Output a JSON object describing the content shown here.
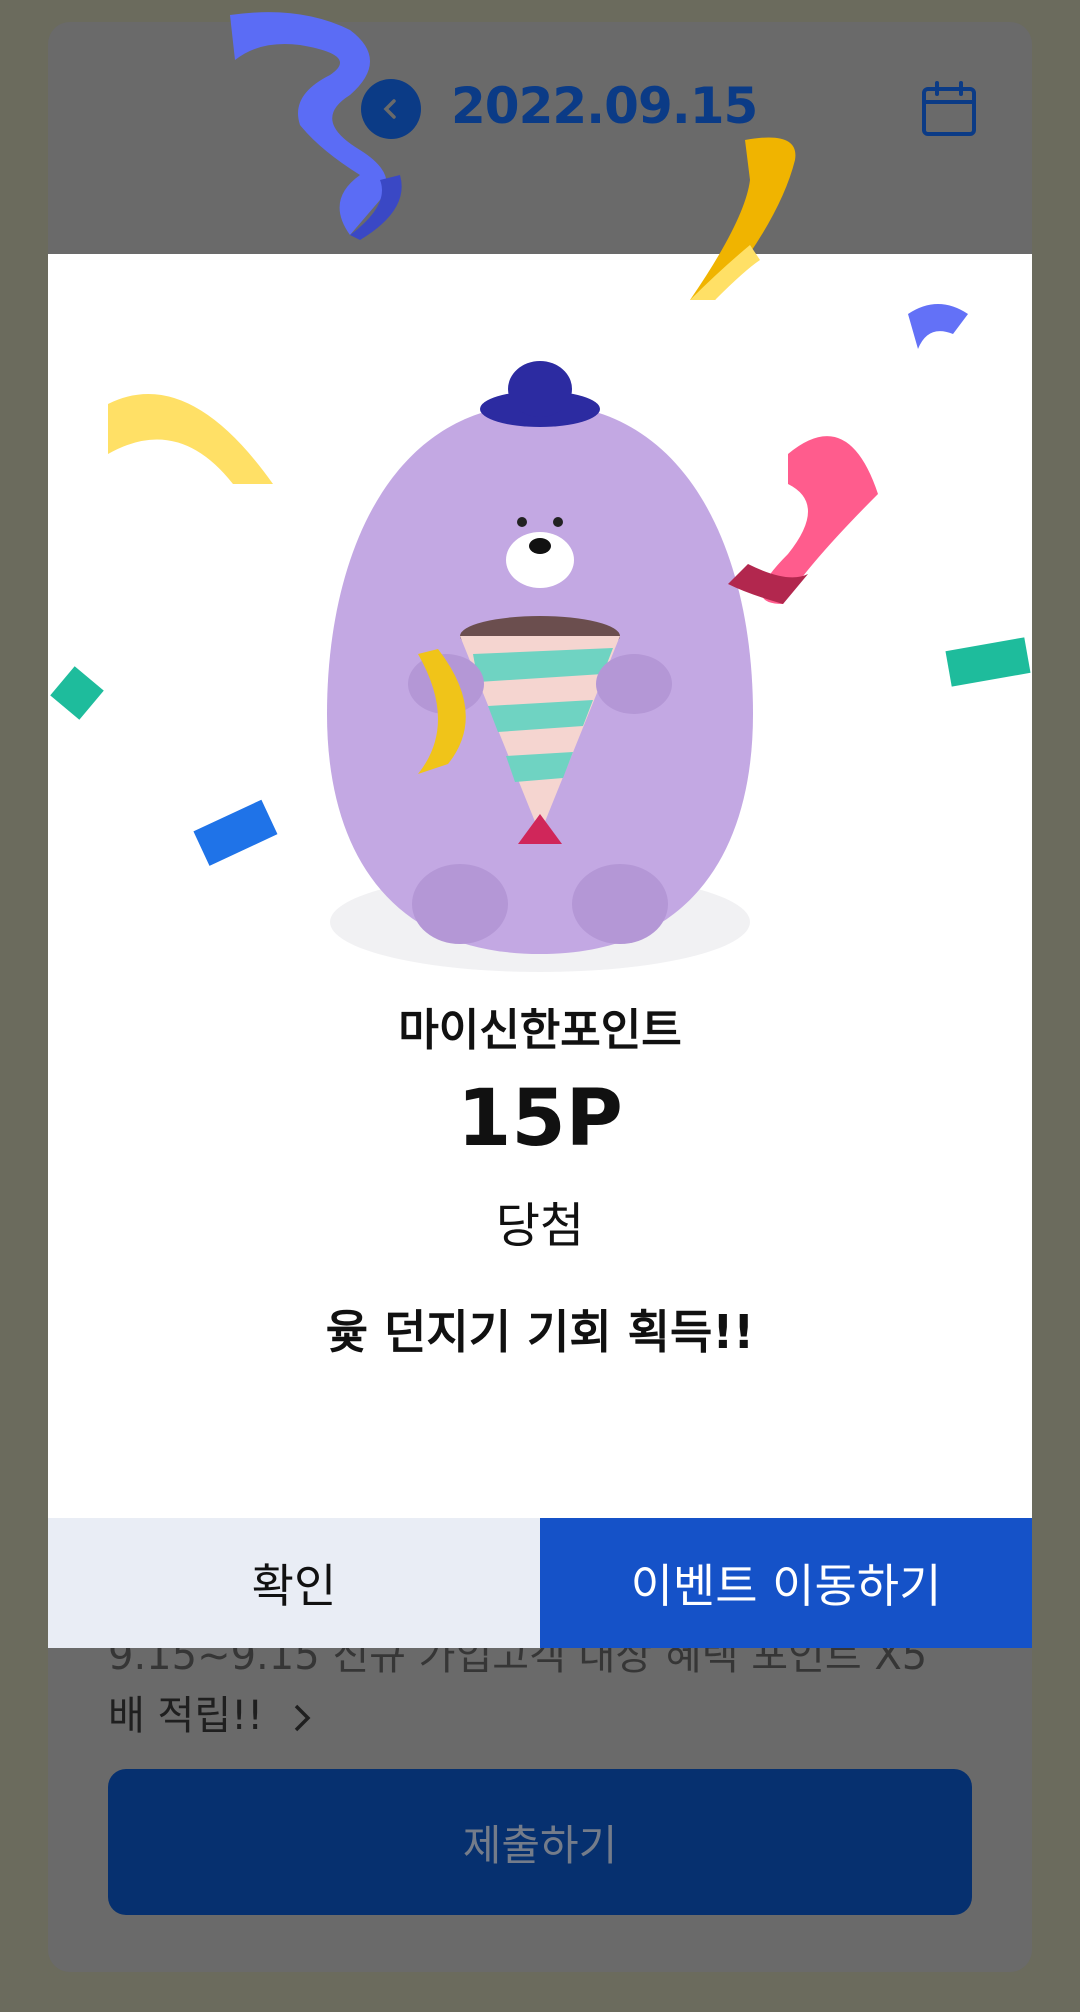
{
  "header": {
    "date": "2022.09.15",
    "back_icon": "chevron-left-icon",
    "calendar_icon": "calendar-icon"
  },
  "background": {
    "partial_line": "9.15~9.15 신규 가입고객 대상 혜택 포인트 X5",
    "line2": "배 적립!!",
    "submit_label": "제출하기"
  },
  "modal": {
    "point_name": "마이신한포인트",
    "point_value": "15P",
    "win_label": "당첨",
    "chance_text": "윷 던지기 기회 획득!!",
    "confirm_label": "확인",
    "event_label": "이벤트 이동하기"
  },
  "colors": {
    "accent": "#1552c8",
    "navy": "#0b3b86",
    "character": "#c3a8e3",
    "dim": "#6a6a6a"
  }
}
